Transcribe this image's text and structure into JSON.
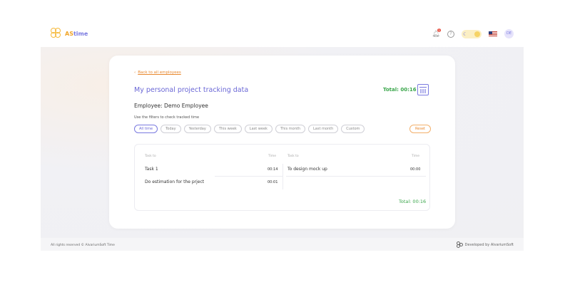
{
  "header": {
    "logo_prefix": "AS",
    "logo_suffix": "time",
    "notification_count": "1",
    "avatar_initials": "DE"
  },
  "card": {
    "back_link": "Back to all employees",
    "title": "My personal project tracking data",
    "total_label": "Total: 00:16",
    "employee": "Employee: Demo Employee",
    "hint": "Use the filters to check tracked time",
    "filters": [
      "All time",
      "Today",
      "Yesterday",
      "This week",
      "Last week",
      "This month",
      "Last month",
      "Custom"
    ],
    "active_filter": "All time",
    "reset_label": "Reset"
  },
  "table": {
    "left": {
      "header_task": "Task to",
      "header_time": "Time",
      "rows": [
        {
          "task": "Task 1",
          "time": "00:14"
        },
        {
          "task": "Do estimation for the prject",
          "time": "00:01"
        }
      ]
    },
    "right": {
      "header_task": "Task to",
      "header_time": "Time",
      "rows": [
        {
          "task": "To design mock up",
          "time": "00:00"
        }
      ]
    },
    "total": "Total: 00:16"
  },
  "footer": {
    "copyright": "All rights reserved © AlvariumSoft Time",
    "developed_by": "Developed by AlvariumSoft"
  },
  "colors": {
    "accent_purple": "#6a67d6",
    "accent_orange": "#e8882e",
    "total_green": "#3aa64b"
  }
}
